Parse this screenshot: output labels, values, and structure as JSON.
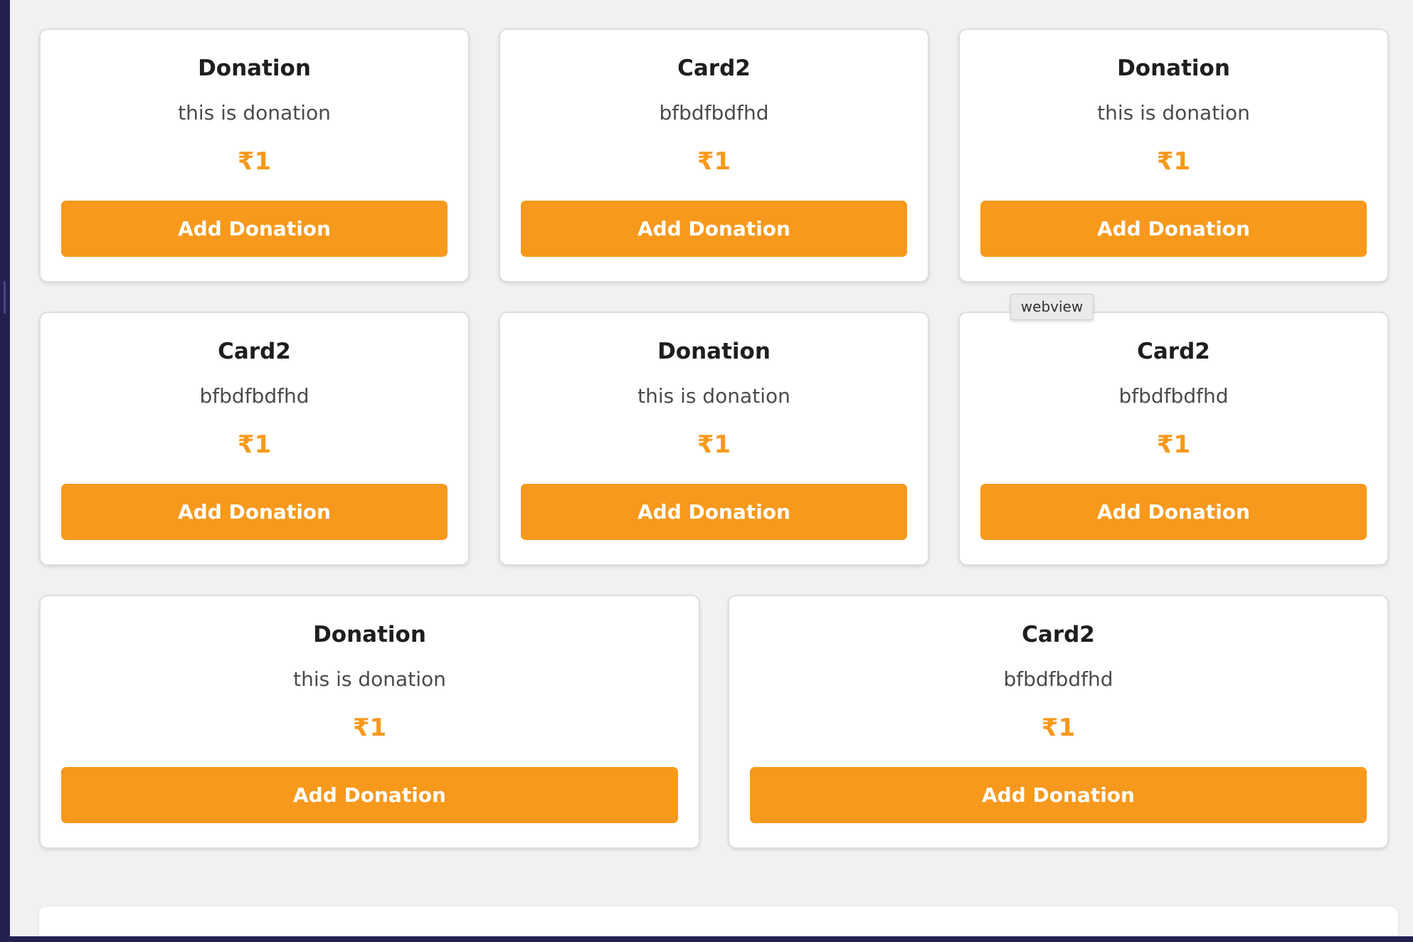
{
  "tooltip": {
    "text": "webview"
  },
  "currency_symbol": "₹",
  "colors": {
    "accent": "#f7991c",
    "background": "#f2f0f2",
    "card": "#ffffff",
    "frame": "#1f1d4a"
  },
  "cards": [
    {
      "title": "Donation",
      "description": "this is donation",
      "price": "₹1",
      "button_label": "Add Donation"
    },
    {
      "title": "Card2",
      "description": "bfbdfbdfhd",
      "price": "₹1",
      "button_label": "Add Donation"
    },
    {
      "title": "Donation",
      "description": "this is donation",
      "price": "₹1",
      "button_label": "Add Donation"
    },
    {
      "title": "Card2",
      "description": "bfbdfbdfhd",
      "price": "₹1",
      "button_label": "Add Donation"
    },
    {
      "title": "Donation",
      "description": "this is donation",
      "price": "₹1",
      "button_label": "Add Donation"
    },
    {
      "title": "Card2",
      "description": "bfbdfbdfhd",
      "price": "₹1",
      "button_label": "Add Donation"
    },
    {
      "title": "Donation",
      "description": "this is donation",
      "price": "₹1",
      "button_label": "Add Donation"
    },
    {
      "title": "Card2",
      "description": "bfbdfbdfhd",
      "price": "₹1",
      "button_label": "Add Donation"
    }
  ]
}
